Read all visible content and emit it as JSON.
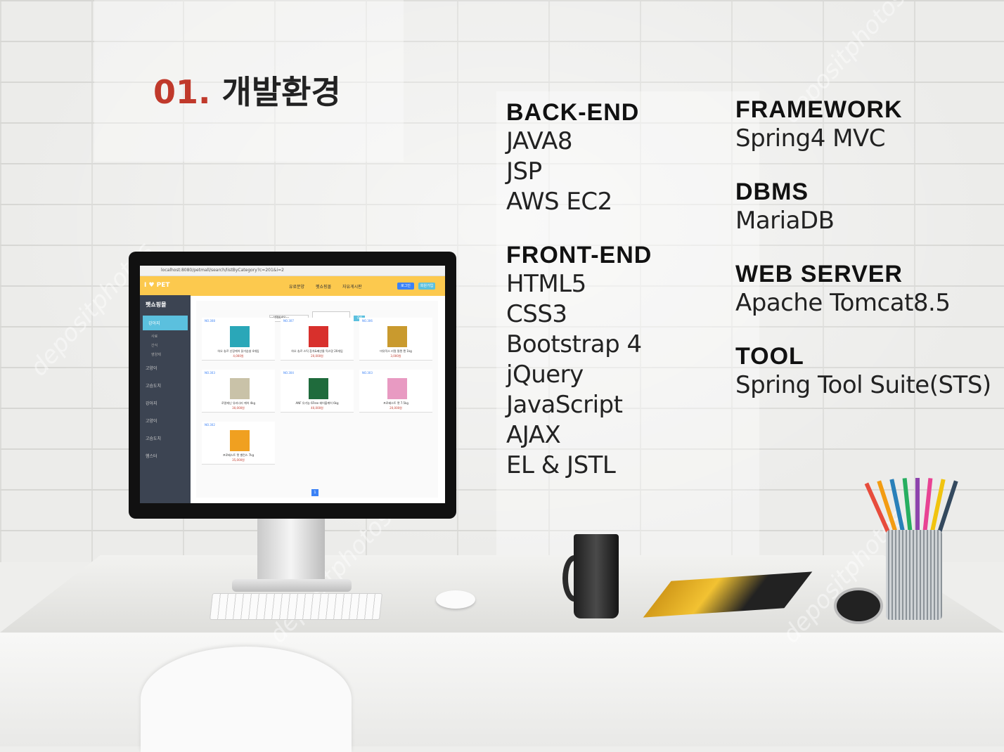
{
  "title": {
    "number": "01.",
    "text": "개발환경"
  },
  "col1": [
    {
      "heading": "BACK-END",
      "items": [
        "JAVA8",
        "JSP",
        "AWS EC2"
      ]
    },
    {
      "heading": "FRONT-END",
      "items": [
        "HTML5",
        "CSS3",
        "Bootstrap 4",
        "jQuery",
        "JavaScript",
        "AJAX",
        "EL & JSTL"
      ]
    }
  ],
  "col2": [
    {
      "heading": "FRAMEWORK",
      "items": [
        "Spring4 MVC"
      ]
    },
    {
      "heading": "DBMS",
      "items": [
        "MariaDB"
      ]
    },
    {
      "heading": "WEB SERVER",
      "items": [
        "Apache Tomcat8.5"
      ]
    },
    {
      "heading": "TOOL",
      "items": [
        "Spring Tool Suite(STS)"
      ]
    }
  ],
  "screen": {
    "url": "localhost:8080/petmall/search/listByCategory?c=201&i=2",
    "logo": "I ♥ PET",
    "nav": [
      "유료분양",
      "펫쇼핑몰",
      "자유게시판"
    ],
    "btn_login": "로그인",
    "btn_join": "회원가입",
    "side_title": "펫쇼핑몰",
    "side_active": "강아지",
    "side_sub": [
      "사료",
      "간식",
      "영양제"
    ],
    "side_items": [
      "고양이",
      "고슴도치",
      "강아지",
      "고양이",
      "고슴도치",
      "햄스터"
    ],
    "select_placeholder": "---선택하세요---",
    "search_btn": "검색",
    "cards": [
      {
        "no": "NO.308",
        "name": "하오 츄르 신장케어 닭가슴살 4개입",
        "price": "4,000원",
        "color": "#2aa7b8"
      },
      {
        "no": "NO.307",
        "name": "하오 츄르 스틱 참치&메산물 믹스맛 20개입",
        "price": "20,000원",
        "color": "#d8302c"
      },
      {
        "no": "NO.306",
        "name": "미유믹스 리얼 필렌 캔 1kg",
        "price": "3,000원",
        "color": "#c99a2e"
      },
      {
        "no": "NO.303",
        "name": "로얄캐닌 유리너리 케어 4kg",
        "price": "30,000원",
        "color": "#c9c2a8"
      },
      {
        "no": "NO.304",
        "name": "ANF 유기농 6Free 헤어볼케어 6kg",
        "price": "40,000원",
        "color": "#1f6b3c"
      },
      {
        "no": "NO.303",
        "name": "프로베스트 캣 7.5kg",
        "price": "20,000원",
        "color": "#e89ac2"
      },
      {
        "no": "NO.302",
        "name": "프로베스트 캣 밸런스 7kg",
        "price": "35,000원",
        "color": "#f0a020"
      }
    ],
    "page": "1"
  }
}
